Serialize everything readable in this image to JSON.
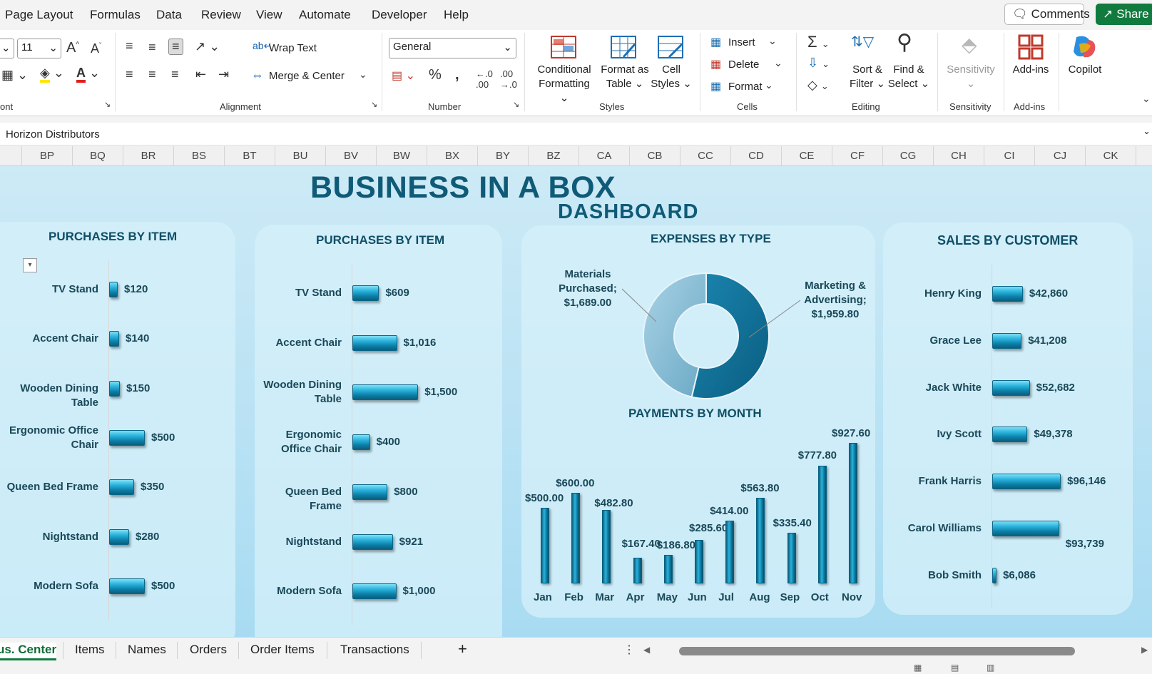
{
  "menu": {
    "items": [
      "Page Layout",
      "Formulas",
      "Data",
      "Review",
      "View",
      "Automate",
      "Developer",
      "Help"
    ],
    "comments": "Comments",
    "share": "Share"
  },
  "ribbon": {
    "font_size": "11",
    "font_group_label": "ont",
    "wrap_text": "Wrap Text",
    "merge_center": "Merge & Center",
    "alignment_label": "Alignment",
    "number_format": "General",
    "number_label": "Number",
    "conditional_formatting": [
      "Conditional",
      "Formatting ⌄"
    ],
    "format_as_table": [
      "Format as",
      "Table ⌄"
    ],
    "cell_styles": [
      "Cell",
      "Styles ⌄"
    ],
    "styles_label": "Styles",
    "insert": "Insert",
    "delete": "Delete",
    "format": "Format",
    "cells_label": "Cells",
    "sort_filter": [
      "Sort &",
      "Filter ⌄"
    ],
    "find_select": [
      "Find &",
      "Select ⌄"
    ],
    "editing_label": "Editing",
    "sensitivity": "Sensitivity",
    "sensitivity_label": "Sensitivity",
    "addins": "Add-ins",
    "addins_label": "Add-ins",
    "copilot": "Copilot"
  },
  "formula_bar": {
    "value": "Horizon Distributors"
  },
  "columns": [
    "BP",
    "BQ",
    "BR",
    "BS",
    "BT",
    "BU",
    "BV",
    "BW",
    "BX",
    "BY",
    "BZ",
    "CA",
    "CB",
    "CC",
    "CD",
    "CE",
    "CF",
    "CG",
    "CH",
    "CI",
    "CJ",
    "CK"
  ],
  "dashboard": {
    "title": "BUSINESS IN A BOX",
    "subtitle": "DASHBOARD"
  },
  "panels": {
    "purchases1": {
      "title": "PURCHASES BY ITEM",
      "items": [
        {
          "label": "TV Stand",
          "value": 120,
          "display": "$120"
        },
        {
          "label": "Accent Chair",
          "value": 140,
          "display": "$140"
        },
        {
          "label": "Wooden Dining Table",
          "value": 150,
          "display": "$150"
        },
        {
          "label": "Ergonomic Office Chair",
          "value": 500,
          "display": "$500"
        },
        {
          "label": "Queen Bed Frame",
          "value": 350,
          "display": "$350"
        },
        {
          "label": "Nightstand",
          "value": 280,
          "display": "$280"
        },
        {
          "label": "Modern Sofa",
          "value": 500,
          "display": "$500"
        }
      ]
    },
    "purchases2": {
      "title": "PURCHASES BY ITEM",
      "items": [
        {
          "label": "TV Stand",
          "value": 609,
          "display": "$609"
        },
        {
          "label": "Accent Chair",
          "value": 1016,
          "display": "$1,016"
        },
        {
          "label": "Wooden Dining Table",
          "value": 1500,
          "display": "$1,500"
        },
        {
          "label": "Ergonomic Office Chair",
          "value": 400,
          "display": "$400"
        },
        {
          "label": "Queen Bed Frame",
          "value": 800,
          "display": "$800"
        },
        {
          "label": "Nightstand",
          "value": 921,
          "display": "$921"
        },
        {
          "label": "Modern Sofa",
          "value": 1000,
          "display": "$1,000"
        }
      ]
    },
    "expenses": {
      "title": "EXPENSES BY TYPE",
      "slices": [
        {
          "label": "Materials Purchased; $1,689.00",
          "value": 1689.0
        },
        {
          "label": "Marketing & Advertising; $1,959.80",
          "value": 1959.8
        }
      ]
    },
    "payments": {
      "title": "PAYMENTS BY MONTH",
      "months": [
        {
          "m": "Jan",
          "value": 500.0,
          "display": "$500.00"
        },
        {
          "m": "Feb",
          "value": 600.0,
          "display": "$600.00"
        },
        {
          "m": "Mar",
          "value": 482.8,
          "display": "$482.80"
        },
        {
          "m": "Apr",
          "value": 167.4,
          "display": "$167.40"
        },
        {
          "m": "May",
          "value": 186.8,
          "display": "$186.80"
        },
        {
          "m": "Jun",
          "value": 285.6,
          "display": "$285.60"
        },
        {
          "m": "Jul",
          "value": 414.0,
          "display": "$414.00"
        },
        {
          "m": "Aug",
          "value": 563.8,
          "display": "$563.80"
        },
        {
          "m": "Sep",
          "value": 335.4,
          "display": "$335.40"
        },
        {
          "m": "Oct",
          "value": 777.8,
          "display": "$777.80"
        },
        {
          "m": "Nov",
          "value": 927.6,
          "display": "$927.60"
        }
      ]
    },
    "sales": {
      "title": "SALES BY CUSTOMER",
      "items": [
        {
          "label": "Henry King",
          "value": 42860,
          "display": "$42,860"
        },
        {
          "label": "Grace Lee",
          "value": 41208,
          "display": "$41,208"
        },
        {
          "label": "Jack White",
          "value": 52682,
          "display": "$52,682"
        },
        {
          "label": "Ivy Scott",
          "value": 49378,
          "display": "$49,378"
        },
        {
          "label": "Frank Harris",
          "value": 96146,
          "display": "$96,146"
        },
        {
          "label": "Carol Williams",
          "value": 93739,
          "display": "$93,739"
        },
        {
          "label": "Bob Smith",
          "value": 6086,
          "display": "$6,086"
        }
      ]
    }
  },
  "sheet_tabs": [
    "us. Center",
    "Items",
    "Names",
    "Orders",
    "Order Items",
    "Transactions"
  ],
  "add_sheet": "+",
  "chart_data": [
    {
      "type": "bar",
      "orientation": "horizontal",
      "title": "PURCHASES BY ITEM",
      "categories": [
        "TV Stand",
        "Accent Chair",
        "Wooden Dining Table",
        "Ergonomic Office Chair",
        "Queen Bed Frame",
        "Nightstand",
        "Modern Sofa"
      ],
      "values": [
        120,
        140,
        150,
        500,
        350,
        280,
        500
      ]
    },
    {
      "type": "bar",
      "orientation": "horizontal",
      "title": "PURCHASES BY ITEM",
      "categories": [
        "TV Stand",
        "Accent Chair",
        "Wooden Dining Table",
        "Ergonomic Office Chair",
        "Queen Bed Frame",
        "Nightstand",
        "Modern Sofa"
      ],
      "values": [
        609,
        1016,
        1500,
        400,
        800,
        921,
        1000
      ]
    },
    {
      "type": "pie",
      "style": "donut",
      "title": "EXPENSES BY TYPE",
      "categories": [
        "Materials Purchased",
        "Marketing & Advertising"
      ],
      "values": [
        1689.0,
        1959.8
      ]
    },
    {
      "type": "bar",
      "title": "PAYMENTS BY MONTH",
      "categories": [
        "Jan",
        "Feb",
        "Mar",
        "Apr",
        "May",
        "Jun",
        "Jul",
        "Aug",
        "Sep",
        "Oct",
        "Nov"
      ],
      "values": [
        500.0,
        600.0,
        482.8,
        167.4,
        186.8,
        285.6,
        414.0,
        563.8,
        335.4,
        777.8,
        927.6
      ]
    },
    {
      "type": "bar",
      "orientation": "horizontal",
      "title": "SALES BY CUSTOMER",
      "categories": [
        "Henry King",
        "Grace Lee",
        "Jack White",
        "Ivy Scott",
        "Frank Harris",
        "Carol Williams",
        "Bob Smith"
      ],
      "values": [
        42860,
        41208,
        52682,
        49378,
        96146,
        93739,
        6086
      ]
    }
  ]
}
